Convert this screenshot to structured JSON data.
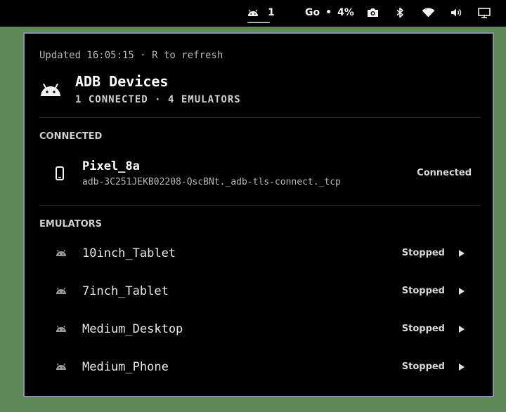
{
  "topbar": {
    "adb_count": "1",
    "go_label": "Go",
    "separator": "•",
    "cpu": "4%"
  },
  "panel": {
    "updated": "Updated 16:05:15 · R to refresh",
    "title": "ADB Devices",
    "subtitle": "1 CONNECTED · 4 EMULATORS"
  },
  "connected": {
    "section_label": "CONNECTED",
    "devices": [
      {
        "name": "Pixel_8a",
        "id": "adb-3C251JEKB02208-QscBNt._adb-tls-connect._tcp",
        "status": "Connected"
      }
    ]
  },
  "emulators": {
    "section_label": "EMULATORS",
    "items": [
      {
        "name": "10inch_Tablet",
        "status": "Stopped"
      },
      {
        "name": "7inch_Tablet",
        "status": "Stopped"
      },
      {
        "name": "Medium_Desktop",
        "status": "Stopped"
      },
      {
        "name": "Medium_Phone",
        "status": "Stopped"
      }
    ]
  }
}
